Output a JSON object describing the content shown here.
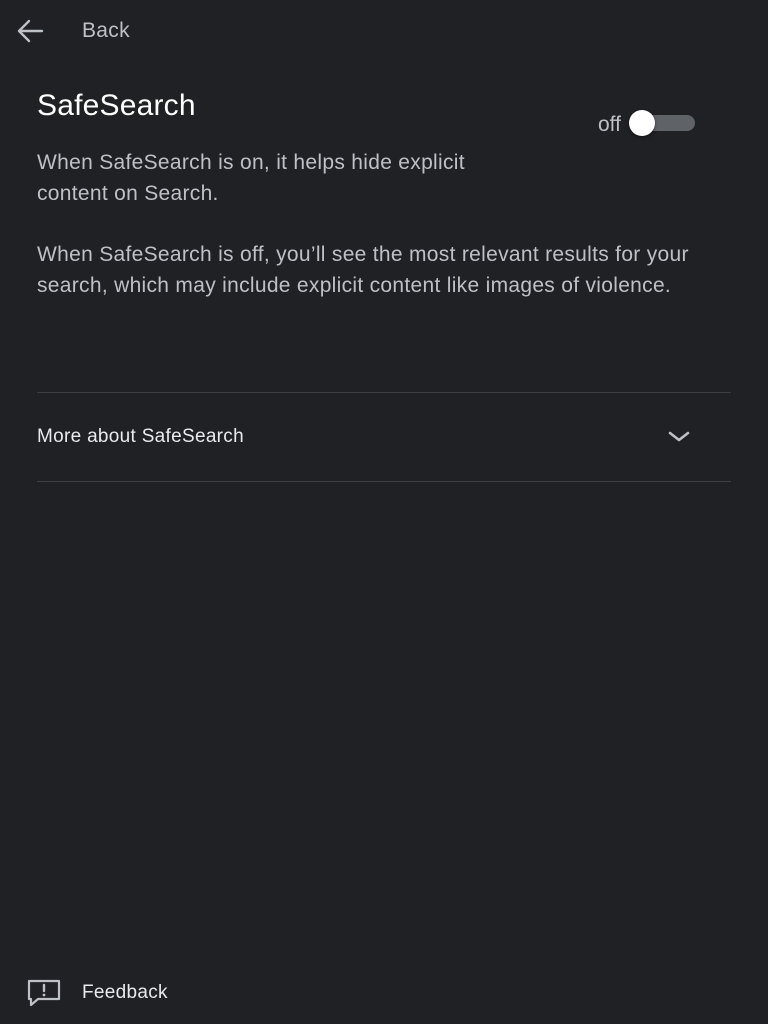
{
  "header": {
    "back_label": "Back",
    "back_icon": "arrow-left-icon"
  },
  "safesearch": {
    "title": "SafeSearch",
    "toggle_state": "off",
    "toggle_on": false,
    "description_on": "When SafeSearch is on, it helps hide explicit content on Search.",
    "description_off": "When SafeSearch is off, you’ll see the most relevant results for your search, which may include explicit content like images of violence."
  },
  "more": {
    "label": "More about SafeSearch",
    "icon": "chevron-down-icon",
    "expanded": false
  },
  "footer": {
    "feedback_label": "Feedback",
    "feedback_icon": "feedback-icon"
  },
  "colors": {
    "background": "#202124",
    "primary_text": "#e8eaed",
    "secondary_text": "#bdc1c6",
    "toggle_track": "#5f6368",
    "toggle_knob": "#ffffff",
    "divider": "#3c4043"
  }
}
